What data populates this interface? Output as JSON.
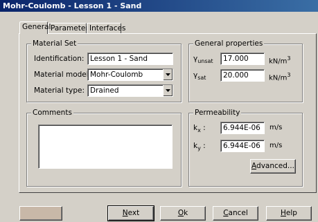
{
  "window": {
    "title": "Mohr-Coulomb - Lesson 1 - Sand"
  },
  "tabs": [
    {
      "label": "General",
      "active": true
    },
    {
      "label": "Parameters",
      "active": false
    },
    {
      "label": "Interfaces",
      "active": false
    }
  ],
  "material_set": {
    "title": "Material Set",
    "identification_label": "Identification:",
    "identification_value": "Lesson 1 - Sand",
    "model_label": "Material model:",
    "model_value": "Mohr-Coulomb",
    "type_label": "Material type:",
    "type_value": "Drained"
  },
  "general_properties": {
    "title": "General properties",
    "gamma_unsat_symbol": "γ",
    "gamma_unsat_sub": "unsat",
    "gamma_unsat_value": "17.000",
    "gamma_sat_symbol": "γ",
    "gamma_sat_sub": "sat",
    "gamma_sat_value": "20.000",
    "unit_base": "kN/m",
    "unit_exp": "3"
  },
  "comments": {
    "title": "Comments",
    "value": ""
  },
  "permeability": {
    "title": "Permeability",
    "kx_symbol": "k",
    "kx_sub": "x",
    "kx_value": "6.944E-06",
    "ky_symbol": "k",
    "ky_sub": "y",
    "ky_value": "6.944E-06",
    "colon": " :",
    "unit": "m/s",
    "advanced_pre": "",
    "advanced_mnemonic": "A",
    "advanced_post": "dvanced..."
  },
  "buttons": {
    "next_mnemonic": "N",
    "next_rest": "ext",
    "ok_mnemonic": "O",
    "ok_rest": "k",
    "cancel_mnemonic": "C",
    "cancel_rest": "ancel",
    "help_mnemonic": "H",
    "help_rest": "elp"
  },
  "colors": {
    "title_bar": "#0a246a",
    "face": "#d4d0c8",
    "disabled_button": "#c8b8a8"
  }
}
